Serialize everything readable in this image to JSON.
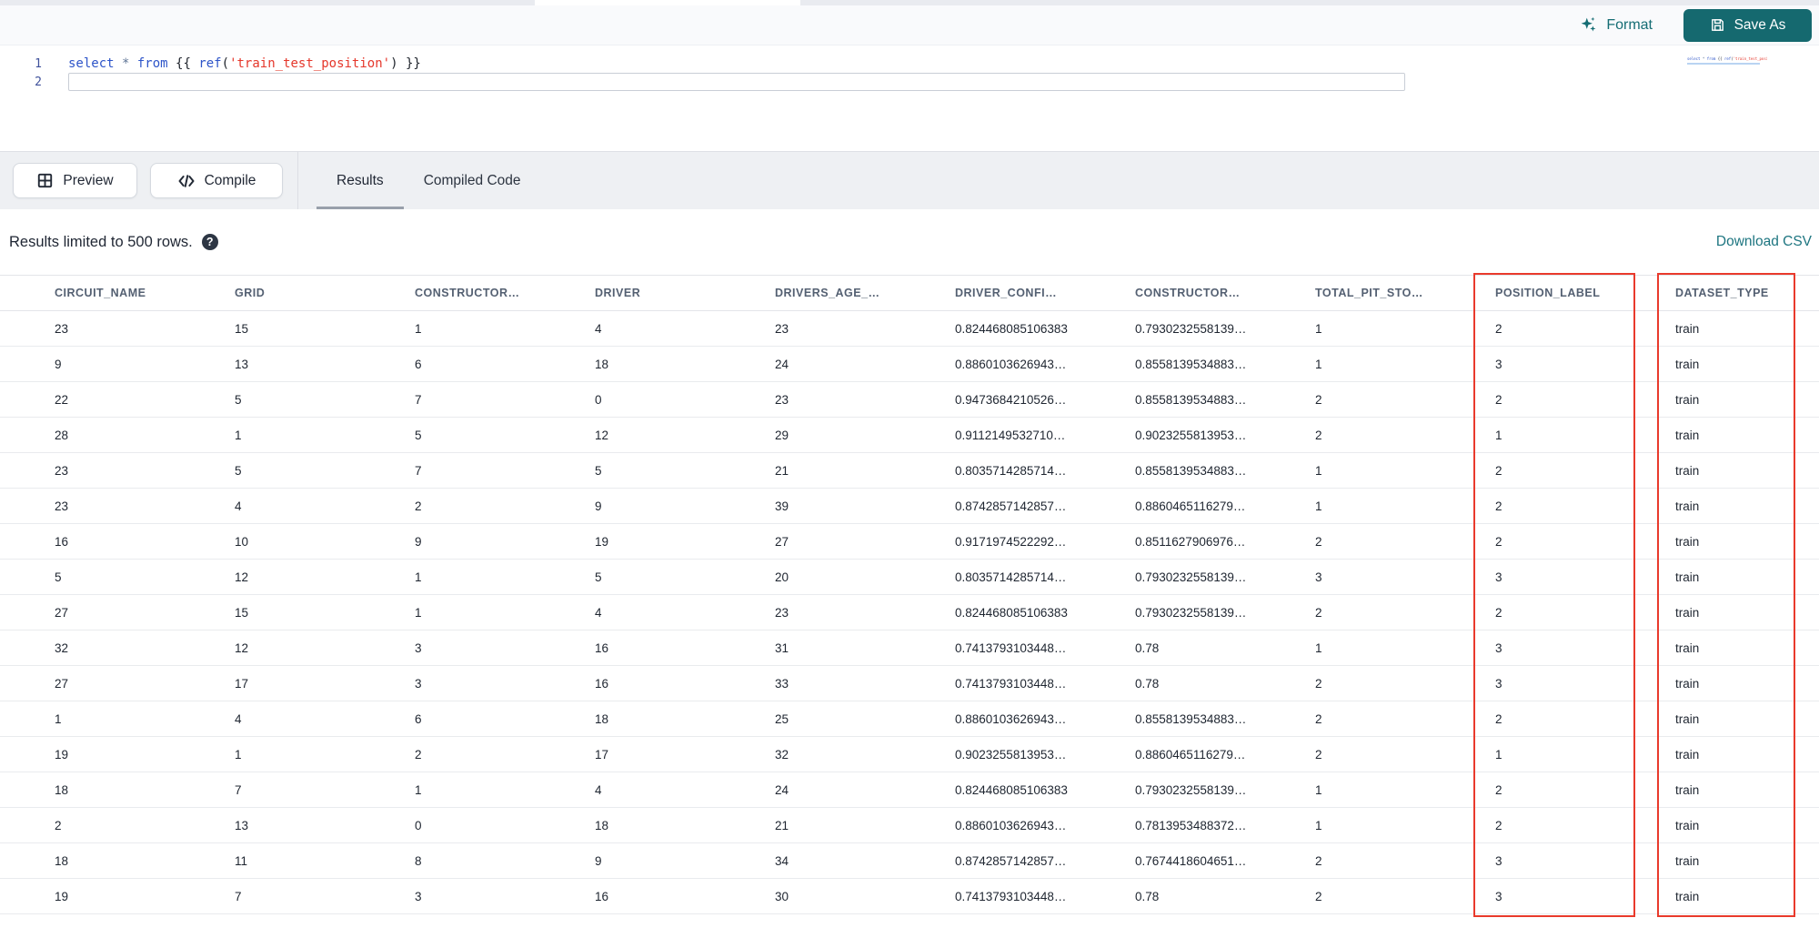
{
  "colors": {
    "accent_teal": "#15696f",
    "teal_text": "#156d74",
    "link_teal": "#1d7580",
    "highlight_red": "#e93a2c"
  },
  "toolbar": {
    "format_label": "Format",
    "save_as_label": "Save As"
  },
  "editor": {
    "line_numbers": [
      "1",
      "2"
    ],
    "token_colors": {
      "keyword": "#2e55c9",
      "function": "#2e55c9",
      "string": "#e5372b",
      "operator": "#5f7596",
      "plain": "#20252d"
    },
    "tokens": [
      {
        "t": "select ",
        "c": "keyword"
      },
      {
        "t": "* ",
        "c": "operator"
      },
      {
        "t": "from ",
        "c": "keyword"
      },
      {
        "t": "{{ ",
        "c": "plain"
      },
      {
        "t": "ref",
        "c": "function"
      },
      {
        "t": "(",
        "c": "plain"
      },
      {
        "t": "'train_test_position'",
        "c": "string"
      },
      {
        "t": ") ",
        "c": "plain"
      },
      {
        "t": "}}",
        "c": "plain"
      }
    ]
  },
  "actions": {
    "preview_label": "Preview",
    "compile_label": "Compile"
  },
  "tabs": [
    {
      "label": "Results"
    },
    {
      "label": "Compiled Code"
    }
  ],
  "results": {
    "limit_text": "Results limited to 500 rows.",
    "help_glyph": "?",
    "download_label": "Download CSV"
  },
  "table": {
    "columns": [
      "CIRCUIT_NAME",
      "GRID",
      "CONSTRUCTOR…",
      "DRIVER",
      "DRIVERS_AGE_…",
      "DRIVER_CONFI…",
      "CONSTRUCTOR…",
      "TOTAL_PIT_STO…",
      "POSITION_LABEL",
      "DATASET_TYPE"
    ],
    "highlighted_columns": [
      "POSITION_LABEL",
      "DATASET_TYPE"
    ],
    "rows": [
      [
        "23",
        "15",
        "1",
        "4",
        "23",
        "0.824468085106383",
        "0.7930232558139…",
        "1",
        "2",
        "train"
      ],
      [
        "9",
        "13",
        "6",
        "18",
        "24",
        "0.8860103626943…",
        "0.8558139534883…",
        "1",
        "3",
        "train"
      ],
      [
        "22",
        "5",
        "7",
        "0",
        "23",
        "0.9473684210526…",
        "0.8558139534883…",
        "2",
        "2",
        "train"
      ],
      [
        "28",
        "1",
        "5",
        "12",
        "29",
        "0.9112149532710…",
        "0.9023255813953…",
        "2",
        "1",
        "train"
      ],
      [
        "23",
        "5",
        "7",
        "5",
        "21",
        "0.8035714285714…",
        "0.8558139534883…",
        "1",
        "2",
        "train"
      ],
      [
        "23",
        "4",
        "2",
        "9",
        "39",
        "0.8742857142857…",
        "0.8860465116279…",
        "1",
        "2",
        "train"
      ],
      [
        "16",
        "10",
        "9",
        "19",
        "27",
        "0.9171974522292…",
        "0.8511627906976…",
        "2",
        "2",
        "train"
      ],
      [
        "5",
        "12",
        "1",
        "5",
        "20",
        "0.8035714285714…",
        "0.7930232558139…",
        "3",
        "3",
        "train"
      ],
      [
        "27",
        "15",
        "1",
        "4",
        "23",
        "0.824468085106383",
        "0.7930232558139…",
        "2",
        "2",
        "train"
      ],
      [
        "32",
        "12",
        "3",
        "16",
        "31",
        "0.7413793103448…",
        "0.78",
        "1",
        "3",
        "train"
      ],
      [
        "27",
        "17",
        "3",
        "16",
        "33",
        "0.7413793103448…",
        "0.78",
        "2",
        "3",
        "train"
      ],
      [
        "1",
        "4",
        "6",
        "18",
        "25",
        "0.8860103626943…",
        "0.8558139534883…",
        "2",
        "2",
        "train"
      ],
      [
        "19",
        "1",
        "2",
        "17",
        "32",
        "0.9023255813953…",
        "0.8860465116279…",
        "2",
        "1",
        "train"
      ],
      [
        "18",
        "7",
        "1",
        "4",
        "24",
        "0.824468085106383",
        "0.7930232558139…",
        "1",
        "2",
        "train"
      ],
      [
        "2",
        "13",
        "0",
        "18",
        "21",
        "0.8860103626943…",
        "0.7813953488372…",
        "1",
        "2",
        "train"
      ],
      [
        "18",
        "11",
        "8",
        "9",
        "34",
        "0.8742857142857…",
        "0.7674418604651…",
        "2",
        "3",
        "train"
      ],
      [
        "19",
        "7",
        "3",
        "16",
        "30",
        "0.7413793103448…",
        "0.78",
        "2",
        "3",
        "train"
      ]
    ]
  }
}
